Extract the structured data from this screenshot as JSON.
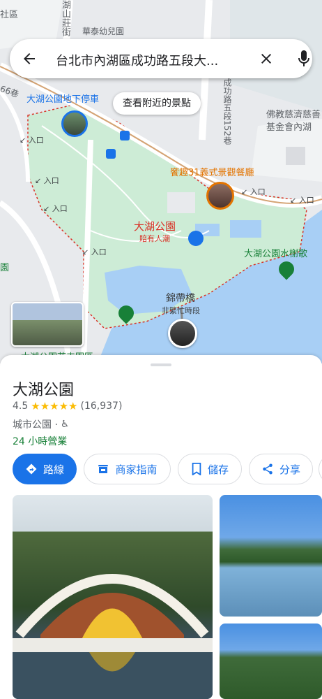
{
  "map": {
    "labels": {
      "top_left": "社區",
      "road_vertical": "湖山莊街",
      "kindergarten": "華泰幼兒園",
      "parking": "大湖公園地下停車",
      "lane": "66巷",
      "road_152": "成功路五段152巷",
      "temple": "佛教慈濟慈善基金會內湖",
      "restaurant": "饗趣31義式景觀餐廳",
      "park_name": "大湖公園",
      "park_sub": "賠有人潮",
      "pavilion": "大湖公園水榭歌",
      "bridge": "錦帶橋",
      "bridge_sub": "非繁忙時段",
      "left_edge": "園",
      "bottom_label": "大湖公園花卉園區",
      "entrances": [
        "入口",
        "入口",
        "入口",
        "入口",
        "入口",
        "入口"
      ]
    }
  },
  "search": {
    "query": "台北市內湖區成功路五段大...",
    "back_icon": "arrow-back-icon",
    "clear_icon": "close-icon",
    "mic_icon": "mic-icon"
  },
  "nearby_chip": "查看附近的景點",
  "place": {
    "name": "大湖公園",
    "rating": "4.5",
    "stars": "★★★★★",
    "reviews": "(16,937)",
    "category": "城市公園 ·",
    "hours": "24 小時營業"
  },
  "actions": [
    {
      "label": "路線",
      "icon": "directions-icon"
    },
    {
      "label": "商家指南",
      "icon": "store-icon"
    },
    {
      "label": "儲存",
      "icon": "bookmark-icon"
    },
    {
      "label": "分享",
      "icon": "share-icon"
    }
  ],
  "colors": {
    "accent": "#1a73e8",
    "open": "#188038",
    "star": "#fbbc04",
    "park": "#cdecd6",
    "water": "#a8cff5"
  }
}
